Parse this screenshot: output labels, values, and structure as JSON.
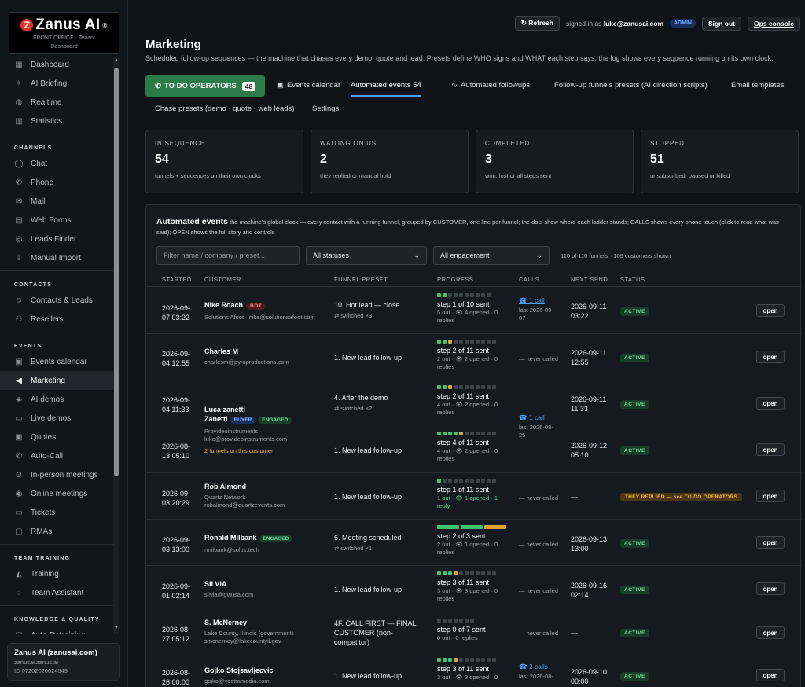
{
  "sidebar": {
    "logo_title": "Zanus AI",
    "logo_mark": "Z",
    "logo_reg": "®",
    "logo_sub": "FRONT OFFICE · Tenant",
    "logo_sub2": "Dashboard",
    "items_top": [
      {
        "label": "Dashboard",
        "icon": "grid-icon",
        "glyph": "▦"
      },
      {
        "label": "AI Briefing",
        "icon": "sparkle-icon",
        "glyph": "✧"
      },
      {
        "label": "Realtime",
        "icon": "globe-icon",
        "glyph": "◍"
      },
      {
        "label": "Statistics",
        "icon": "bar-chart-icon",
        "glyph": "▥"
      }
    ],
    "sec_channels": "CHANNELS",
    "items_channels": [
      {
        "label": "Chat",
        "icon": "chat-icon",
        "glyph": "◯"
      },
      {
        "label": "Phone",
        "icon": "phone-icon",
        "glyph": "✆"
      },
      {
        "label": "Mail",
        "icon": "mail-icon",
        "glyph": "✉"
      },
      {
        "label": "Web Forms",
        "icon": "form-icon",
        "glyph": "▤"
      },
      {
        "label": "Leads Finder",
        "icon": "finder-icon",
        "glyph": "◎"
      },
      {
        "label": "Manual Import",
        "icon": "import-icon",
        "glyph": "⇩"
      }
    ],
    "sec_contacts": "CONTACTS",
    "items_contacts": [
      {
        "label": "Contacts & Leads",
        "icon": "users-icon",
        "glyph": "☺"
      },
      {
        "label": "Resellers",
        "icon": "handshake-icon",
        "glyph": "⚇"
      }
    ],
    "sec_events": "EVENTS",
    "items_events": [
      {
        "label": "Events calendar",
        "icon": "calendar-icon",
        "glyph": "▣"
      },
      {
        "label": "Marketing",
        "icon": "megaphone-icon",
        "glyph": "◀"
      },
      {
        "label": "AI demos",
        "icon": "ai-demo-icon",
        "glyph": "◈"
      },
      {
        "label": "Live demos",
        "icon": "monitor-icon",
        "glyph": "▭"
      },
      {
        "label": "Quotes",
        "icon": "quote-icon",
        "glyph": "▣"
      },
      {
        "label": "Auto-Call",
        "icon": "auto-call-icon",
        "glyph": "✆"
      },
      {
        "label": "In-person meetings",
        "icon": "pin-icon",
        "glyph": "⊙"
      },
      {
        "label": "Online meetings",
        "icon": "online-icon",
        "glyph": "◉"
      },
      {
        "label": "Tickets",
        "icon": "ticket-icon",
        "glyph": "▭"
      },
      {
        "label": "RMAs",
        "icon": "rma-icon",
        "glyph": "▢"
      }
    ],
    "sec_training": "TEAM TRAINING",
    "items_training": [
      {
        "label": "Training",
        "icon": "graduation-icon",
        "glyph": "◭"
      },
      {
        "label": "Team Assistant",
        "icon": "assistant-icon",
        "glyph": "◌"
      }
    ],
    "sec_knowledge": "KNOWLEDGE & QUALITY",
    "items_knowledge": [
      {
        "label": "Auto-Retraining",
        "icon": "retrain-icon",
        "glyph": "▤"
      }
    ],
    "active": "Marketing",
    "account": {
      "name": "Zanus AI (zanusai.com)",
      "domain": "zanusai.zanus.ai",
      "id": "ID 07202026024549"
    }
  },
  "topbar": {
    "refresh": "↻ Refresh",
    "signed_prefix": "signed in as",
    "email": "luke@zanusai.com",
    "role": "ADMIN",
    "signout": "Sign out",
    "ops": "Ops console"
  },
  "page": {
    "title": "Marketing",
    "description": "Scheduled follow-up sequences — the machine that chases every demo, quote and lead. Presets define WHO signs and WHAT each step says; the log shows every sequence running on its own clock."
  },
  "tabs": {
    "todo_label": "TO DO OPERATORS",
    "todo_count": "48",
    "events_calendar": "Events calendar",
    "automated_events": "Automated events 54",
    "automated_followups": "Automated followups",
    "funnels_presets": "Follow-up funnels presets (AI direction scripts)",
    "email_templates": "Email templates",
    "chase_presets": "Chase presets (demo · quote · web leads)",
    "settings": "Settings"
  },
  "stats": [
    {
      "label": "IN SEQUENCE",
      "value": "54",
      "desc": "funnels + sequences on their own clocks"
    },
    {
      "label": "WAITING ON US",
      "value": "2",
      "desc": "they replied or manual hold"
    },
    {
      "label": "COMPLETED",
      "value": "3",
      "desc": "won, lost or all steps sent"
    },
    {
      "label": "STOPPED",
      "value": "51",
      "desc": "unsubscribed, paused or killed"
    }
  ],
  "panel": {
    "title": "Automated events",
    "subtitle": "the machine's global clock — every contact with a running funnel, grouped by CUSTOMER, one line per funnel; the dots show where each ladder stands; CALLS shows every phone touch (click to read what was said); OPEN shows the full story and controls",
    "filter_placeholder": "Filter name / company / preset...",
    "status_select": "All statuses",
    "engagement_select": "All engagement",
    "count_text": "110 of 110 funnels · 109 customers shown",
    "headers": {
      "started": "STARTED",
      "customer": "CUSTOMER",
      "preset": "FUNNEL PRESET",
      "progress": "PROGRESS",
      "calls": "CALLS",
      "next": "NEXT SEND",
      "status": "STATUS"
    },
    "open_label": "open"
  },
  "rows": {
    "r1": {
      "started_a": "2026-09-",
      "started_b": "07 03:22",
      "name": "Nike Roach",
      "badge": "HOT",
      "sub": "Solutions Afoot · nike@solutionsafoot.com",
      "preset": "10. Hot lead — close",
      "preset_sub": "⇄ switched ×3",
      "step": "step 1 of 10 sent",
      "prog_a": "5 out · 👁 4 opened · 0",
      "prog_b": "replies",
      "calls": "☎ 1 call",
      "calls_a": "last 2026-09-",
      "calls_b": "07",
      "next_a": "2026-09-11",
      "next_b": "03:22",
      "status": "ACTIVE",
      "dots": [
        1,
        1,
        0,
        0,
        0,
        0,
        0,
        0,
        0,
        0
      ]
    },
    "r2": {
      "started_a": "2026-09-",
      "started_b": "04 12:55",
      "name": "Charles M",
      "sub": "charlesm@pyroproductions.com",
      "preset": "1. New lead follow-up",
      "step": "step 2 of 11 sent",
      "prog_a": "2 out · 👁 2 opened · 0",
      "prog_b": "replies",
      "calls": "— never called",
      "next_a": "2026-09-11",
      "next_b": "12:55",
      "status": "ACTIVE",
      "dots": [
        1,
        1,
        2,
        0,
        0,
        0,
        0,
        0,
        0,
        0,
        0
      ]
    },
    "r3": {
      "started_a": "2026-09-",
      "started_b": "04 11:33",
      "name_a": "Luca zanetti",
      "name_b": "Zanetti",
      "badge1": "BUYER",
      "badge2": "ENGAGED",
      "sub_a": "Provideoinstruments ·",
      "sub_b": "luke@provideoinstruments.com",
      "funnels": "2 funnels on this customer",
      "preset": "4. After the demo",
      "preset_sub": "⇄ switched ×2",
      "step": "step 2 of 11 sent",
      "prog_a": "4 out · 👁 2 opened · 0",
      "prog_b": "replies",
      "calls": "☎ 1 call",
      "calls_a": "last 2026-08-",
      "calls_b": "25",
      "next_a": "2026-09-11",
      "next_b": "11:33",
      "status": "ACTIVE",
      "dots": [
        1,
        1,
        2,
        0,
        0,
        0,
        0,
        0,
        0,
        0,
        0
      ]
    },
    "r3b": {
      "started_a": "2026-08-",
      "started_b": "13 05:10",
      "preset": "1. New lead follow-up",
      "step": "step 4 of 11 sent",
      "prog_a": "4 out · 👁 2 opened · 0",
      "prog_b": "replies",
      "next_a": "2026-09-12",
      "next_b": "05:10",
      "status": "ACTIVE",
      "dots": [
        1,
        1,
        1,
        1,
        2,
        0,
        0,
        0,
        0,
        0,
        0
      ]
    },
    "r4": {
      "started_a": "2026-09-",
      "started_b": "03 20:29",
      "name": "Rob Almond",
      "sub_a": "Quartz Network ·",
      "sub_b": "robalmond@quartzevents.com",
      "preset": "1. New lead follow-up",
      "step": "step 1 of 11 sent",
      "prog_a": "1 out · 👁 1 opened · 1",
      "prog_b": "reply",
      "calls": "— never called",
      "next": "—",
      "status": "THEY REPLIED — see TO DO OPERATORS",
      "dots": [
        1,
        0,
        0,
        0,
        0,
        0,
        0,
        0,
        0,
        0,
        0
      ]
    },
    "r5": {
      "started_a": "2026-09-",
      "started_b": "03 13:00",
      "name": "Ronald Milbank",
      "badge": "ENGAGED",
      "sub": "rmilbank@solus.tech",
      "preset": "6. Meeting scheduled",
      "preset_sub": "⇄ switched ×1",
      "step": "step 2 of 3 sent",
      "prog_a": "2 out · 👁 1 opened · 0",
      "prog_b": "replies",
      "calls": "— never called",
      "next_a": "2026-09-13",
      "next_b": "13:00",
      "status": "ACTIVE"
    },
    "r6": {
      "started_a": "2026-09-",
      "started_b": "01 02:14",
      "name": "SILVIA",
      "sub": "silvia@pvlusa.com",
      "preset": "1. New lead follow-up",
      "step": "step 3 of 11 sent",
      "prog_a": "3 out · 👁 3 opened · 0",
      "prog_b": "replies",
      "calls": "— never called",
      "next_a": "2026-09-16",
      "next_b": "02:14",
      "status": "ACTIVE",
      "dots": [
        1,
        1,
        1,
        2,
        0,
        0,
        0,
        0,
        0,
        0,
        0
      ]
    },
    "r7": {
      "started_a": "2026-08-",
      "started_b": "27 05:12",
      "name": "S. McNerney",
      "sub_a": "Lake County, Illinois (government) ·",
      "sub_b": "smcnerney@lakecountyil.gov",
      "preset_a": "4F. CALL FIRST — FINAL",
      "preset_b": "CUSTOMER (non-",
      "preset_c": "competitor)",
      "step": "step 0 of 7 sent",
      "prog_a": "0 out · 0 replies",
      "calls": "— never called",
      "next": "—",
      "status": "ACTIVE",
      "dots": [
        0,
        0,
        0,
        0,
        0,
        0,
        0
      ]
    },
    "r8": {
      "started_a": "2026-08-",
      "started_b": "26 00:00",
      "name": "Gojko Stojsavljecvic",
      "sub": "gojko@vectramedia.com",
      "preset": "1. New lead follow-up",
      "step": "step 3 of 11 sent",
      "prog_a": "3 out · 👁 3 opened · 0",
      "calls": "☎ 2 calls",
      "calls_a": "last 2026-08-",
      "next_a": "2026-09-10",
      "next_b": "00:00",
      "status": "ACTIVE",
      "dots": [
        1,
        1,
        1,
        2,
        0,
        0,
        0,
        0,
        0,
        0,
        0
      ]
    }
  }
}
